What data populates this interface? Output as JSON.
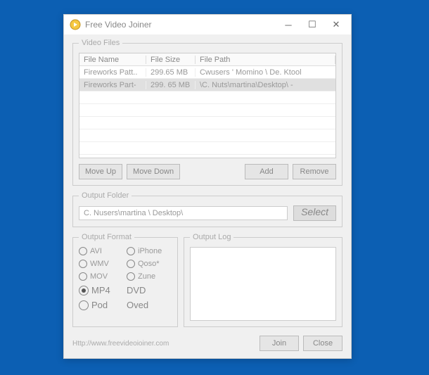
{
  "window": {
    "title": "Free Video Joiner"
  },
  "videoFiles": {
    "legend": "Video Files",
    "headers": {
      "name": "File Name",
      "size": "File Size",
      "path": "File Path"
    },
    "rows": [
      {
        "name": "Fireworks Patt..",
        "size": "299.65 MB",
        "path": "Cwusers ' Momino \\ De. Ktool"
      },
      {
        "name": "Fireworks Part-",
        "size": "299. 65 MB",
        "path": "\\C. Nuts\\martina\\Desktop\\ -"
      }
    ],
    "buttons": {
      "moveUp": "Move Up",
      "moveDown": "Move Down",
      "add": "Add",
      "remove": "Remove"
    }
  },
  "outputFolder": {
    "legend": "Output Folder",
    "value": "C. Nusers\\martina \\ Desktop\\",
    "select": "Select"
  },
  "outputFormat": {
    "legend": "Output Format",
    "options": {
      "avi": "AVI",
      "iphone": "iPhone",
      "wmv": "WMV",
      "qoso": "Qoso*",
      "mov": "MOV",
      "zune": "Zune",
      "mp4": "MP4",
      "dvd": "DVD",
      "pod": "Pod",
      "oved": "Oved"
    },
    "selected": "mp4"
  },
  "outputLog": {
    "legend": "Output Log"
  },
  "footer": {
    "url": "Http://www.freevideoioiner.com",
    "join": "Join",
    "close": "Close"
  }
}
